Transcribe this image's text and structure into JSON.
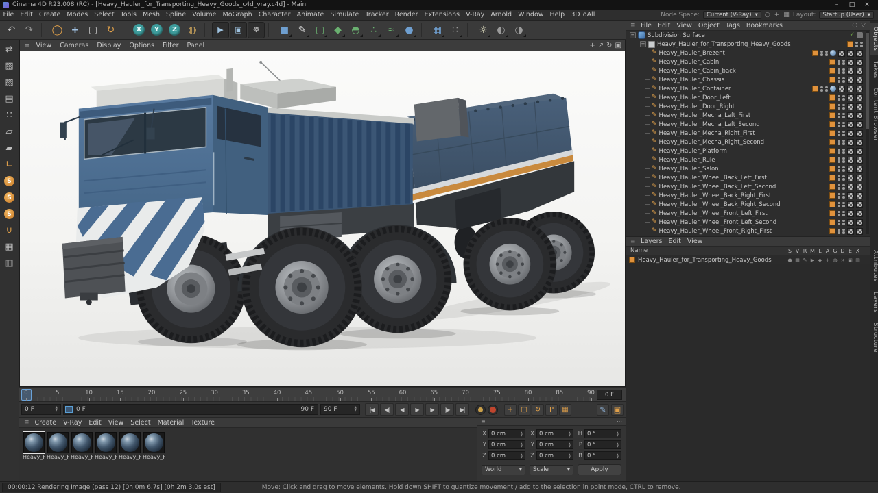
{
  "window": {
    "title": "Cinema 4D R23.008 (RC) - [Heavy_Hauler_for_Transporting_Heavy_Goods_c4d_vray.c4d] - Main",
    "minimize": "–",
    "maximize": "□",
    "close": "×"
  },
  "icons": {
    "burger": "≡",
    "dots": "⋯",
    "caret": "▾",
    "minus": "−",
    "spin_up": "▲",
    "spin_down": "▼",
    "mesh_glyph": "✎",
    "check": "✓"
  },
  "menu_bar": {
    "items": [
      "File",
      "Edit",
      "Create",
      "Modes",
      "Select",
      "Tools",
      "Mesh",
      "Spline",
      "Volume",
      "MoGraph",
      "Character",
      "Animate",
      "Simulate",
      "Tracker",
      "Render",
      "Extensions",
      "V-Ray",
      "Arnold",
      "Window",
      "Help",
      "3DToAll"
    ],
    "node_space_label": "Node Space:",
    "node_space_value": "Current (V-Ray)",
    "layout_label": "Layout:",
    "layout_value": "Startup (User)",
    "right_icons": [
      {
        "name": "search-icon",
        "glyph": "○"
      },
      {
        "name": "customize-icon",
        "glyph": "+"
      },
      {
        "name": "panels-icon",
        "glyph": "▦"
      }
    ]
  },
  "toolbar": {
    "buttons": [
      {
        "name": "undo-button",
        "glyph": "↶",
        "color": "#c6c6c6"
      },
      {
        "name": "redo-button",
        "glyph": "↷",
        "color": "#8f8f8f"
      },
      {
        "sep": true
      },
      {
        "name": "live-selection-button",
        "glyph": "◯",
        "color": "#e0a04a"
      },
      {
        "name": "move-tool-button",
        "glyph": "+",
        "color": "#9fc0e0",
        "bold": true
      },
      {
        "name": "scale-tool-button",
        "glyph": "▢",
        "color": "#c6c6c6"
      },
      {
        "name": "rotate-tool-button",
        "glyph": "↻",
        "color": "#e0a04a"
      },
      {
        "sep": true
      },
      {
        "name": "x-axis-lock-button",
        "glyph": "X",
        "circle": "#3e9c9c"
      },
      {
        "name": "y-axis-lock-button",
        "glyph": "Y",
        "circle": "#3e9c9c"
      },
      {
        "name": "z-axis-lock-button",
        "glyph": "Z",
        "circle": "#3e9c9c"
      },
      {
        "name": "coordinate-system-button",
        "glyph": "◍",
        "color": "#c6a05a"
      },
      {
        "sep": true
      },
      {
        "name": "render-view-button",
        "glyph": "▶",
        "color": "#9fc3e0",
        "boxed": true
      },
      {
        "name": "render-picture-viewer-button",
        "glyph": "▣",
        "color": "#9fc3e0",
        "boxed": true
      },
      {
        "name": "render-settings-button",
        "glyph": "☸",
        "color": "#c2c2c2",
        "boxed": true
      },
      {
        "sep": true
      },
      {
        "name": "add-cube-button",
        "glyph": "■",
        "color": "#6f9fd0",
        "flyout": true
      },
      {
        "name": "spline-pen-button",
        "glyph": "✎",
        "color": "#d0d0d0",
        "flyout": true
      },
      {
        "name": "subdivision-surface-button",
        "glyph": "▢",
        "color": "#6ab070",
        "flyout": true
      },
      {
        "name": "symmetry-button",
        "glyph": "◆",
        "color": "#6ab070",
        "flyout": true
      },
      {
        "name": "boole-button",
        "glyph": "◓",
        "color": "#6ab070",
        "flyout": true
      },
      {
        "name": "cloner-button",
        "glyph": "∴",
        "color": "#6ab070",
        "flyout": true
      },
      {
        "name": "field-button",
        "glyph": "≈",
        "color": "#6ab070",
        "flyout": true
      },
      {
        "name": "volume-builder-button",
        "glyph": "●",
        "color": "#6f9fd0",
        "flyout": true
      },
      {
        "sep": true
      },
      {
        "name": "mograph-table-button",
        "glyph": "▦",
        "color": "#6f9fd0",
        "flyout": true
      },
      {
        "name": "particles-button",
        "glyph": "∷",
        "color": "#9b9b9b",
        "flyout": true
      },
      {
        "sep": true
      },
      {
        "name": "light-button",
        "glyph": "☼",
        "color": "#e6e4c6",
        "flyout": true
      },
      {
        "name": "sky-button",
        "glyph": "◐",
        "color": "#9b9b9b",
        "flyout": true
      },
      {
        "name": "environment-button",
        "glyph": "◑",
        "color": "#9b9b9b",
        "flyout": true
      }
    ]
  },
  "left_toolbar": {
    "buttons": [
      {
        "name": "make-editable-button",
        "glyph": "⇄",
        "color": "#bcbcbc"
      },
      {
        "name": "model-mode-button",
        "glyph": "▧",
        "color": "#bcbcbc"
      },
      {
        "name": "texture-mode-button",
        "glyph": "▨",
        "color": "#bcbcbc"
      },
      {
        "name": "workplane-mode-button",
        "glyph": "▤",
        "color": "#bcbcbc"
      },
      {
        "name": "points-mode-button",
        "glyph": "∷",
        "color": "#bcbcbc"
      },
      {
        "name": "edges-mode-button",
        "glyph": "▱",
        "color": "#bcbcbc"
      },
      {
        "name": "polygons-mode-button",
        "glyph": "▰",
        "color": "#bcbcbc"
      },
      {
        "name": "enable-axis-button",
        "glyph": "∟",
        "color": "#e0a04a"
      },
      {
        "name": "viewport-solo-off-button",
        "glyph": "S",
        "round": true
      },
      {
        "name": "viewport-solo-single-button",
        "glyph": "S",
        "round": true
      },
      {
        "name": "viewport-solo-hierarchy-button",
        "glyph": "S",
        "round": true
      },
      {
        "name": "snap-button",
        "glyph": "∪",
        "color": "#e0a04a"
      },
      {
        "name": "quantize-button",
        "glyph": "▦",
        "color": "#bcbcbc"
      },
      {
        "name": "workplane-lock-button",
        "glyph": "▥",
        "color": "#8f8f8f"
      }
    ]
  },
  "viewport": {
    "menu_items": [
      "View",
      "Cameras",
      "Display",
      "Options",
      "Filter",
      "Panel"
    ],
    "nav_icons": [
      {
        "name": "pan-view-icon",
        "glyph": "+"
      },
      {
        "name": "zoom-view-icon",
        "glyph": "↗"
      },
      {
        "name": "rotate-view-icon",
        "glyph": "↻"
      },
      {
        "name": "toggle-view-icon",
        "glyph": "▣"
      }
    ]
  },
  "viewport_scene": {
    "model": "Heavy Hauler for Transporting Heavy Goods",
    "view": "three-quarter front-left perspective",
    "colors": {
      "cabin_blue": "#4e6f93",
      "container_blue": "#41556b",
      "accent_orange": "#c98a3e",
      "camo_white": "#e9ebeb",
      "tire": "#2a2b2d",
      "hub": "#8e9195",
      "background_top": "#fbfbfa",
      "background_bottom": "#e7e7e5"
    }
  },
  "object_manager": {
    "menu_items": [
      "File",
      "Edit",
      "View",
      "Object",
      "Tags",
      "Bookmarks"
    ],
    "menu_icons": [
      {
        "name": "search-icon",
        "glyph": "○"
      },
      {
        "name": "filter-icon",
        "glyph": "▽"
      }
    ],
    "rows": [
      {
        "label": "Subdivision Surface",
        "level": 0,
        "type": "sds",
        "expander": true,
        "tags": [
          "check",
          "gray"
        ]
      },
      {
        "label": "Heavy_Hauler_for_Transporting_Heavy_Goods",
        "level": 1,
        "type": "null",
        "expander": true,
        "tags": [
          "layer",
          "dots"
        ]
      },
      {
        "label": "Heavy_Hauler_Brezent",
        "level": 2,
        "type": "mesh",
        "tags": [
          "layer",
          "dots",
          "ball",
          "mat",
          "mat",
          "mat"
        ]
      },
      {
        "label": "Heavy_Hauler_Cabin",
        "level": 2,
        "type": "mesh",
        "tags": [
          "layer",
          "dots",
          "mat",
          "mat"
        ]
      },
      {
        "label": "Heavy_Hauler_Cabin_back",
        "level": 2,
        "type": "mesh",
        "tags": [
          "layer",
          "dots",
          "mat",
          "mat"
        ]
      },
      {
        "label": "Heavy_Hauler_Chassis",
        "level": 2,
        "type": "mesh",
        "tags": [
          "layer",
          "dots",
          "mat",
          "mat"
        ]
      },
      {
        "label": "Heavy_Hauler_Container",
        "level": 2,
        "type": "mesh",
        "tags": [
          "layer",
          "dots",
          "ball",
          "mat",
          "mat",
          "mat"
        ]
      },
      {
        "label": "Heavy_Hauler_Door_Left",
        "level": 2,
        "type": "mesh",
        "tags": [
          "layer",
          "dots",
          "mat",
          "mat"
        ]
      },
      {
        "label": "Heavy_Hauler_Door_Right",
        "level": 2,
        "type": "mesh",
        "tags": [
          "layer",
          "dots",
          "mat",
          "mat"
        ]
      },
      {
        "label": "Heavy_Hauler_Mecha_Left_First",
        "level": 2,
        "type": "mesh",
        "tags": [
          "layer",
          "dots",
          "mat",
          "mat"
        ]
      },
      {
        "label": "Heavy_Hauler_Mecha_Left_Second",
        "level": 2,
        "type": "mesh",
        "tags": [
          "layer",
          "dots",
          "mat",
          "mat"
        ]
      },
      {
        "label": "Heavy_Hauler_Mecha_Right_First",
        "level": 2,
        "type": "mesh",
        "tags": [
          "layer",
          "dots",
          "mat",
          "mat"
        ]
      },
      {
        "label": "Heavy_Hauler_Mecha_Right_Second",
        "level": 2,
        "type": "mesh",
        "tags": [
          "layer",
          "dots",
          "mat",
          "mat"
        ]
      },
      {
        "label": "Heavy_Hauler_Platform",
        "level": 2,
        "type": "mesh",
        "tags": [
          "layer",
          "dots",
          "mat",
          "mat"
        ]
      },
      {
        "label": "Heavy_Hauler_Rule",
        "level": 2,
        "type": "mesh",
        "tags": [
          "layer",
          "dots",
          "mat",
          "mat"
        ]
      },
      {
        "label": "Heavy_Hauler_Salon",
        "level": 2,
        "type": "mesh",
        "tags": [
          "layer",
          "dots",
          "mat",
          "mat"
        ]
      },
      {
        "label": "Heavy_Hauler_Wheel_Back_Left_First",
        "level": 2,
        "type": "mesh",
        "tags": [
          "layer",
          "dots",
          "mat",
          "mat"
        ]
      },
      {
        "label": "Heavy_Hauler_Wheel_Back_Left_Second",
        "level": 2,
        "type": "mesh",
        "tags": [
          "layer",
          "dots",
          "mat",
          "mat"
        ]
      },
      {
        "label": "Heavy_Hauler_Wheel_Back_Right_First",
        "level": 2,
        "type": "mesh",
        "tags": [
          "layer",
          "dots",
          "mat",
          "mat"
        ]
      },
      {
        "label": "Heavy_Hauler_Wheel_Back_Right_Second",
        "level": 2,
        "type": "mesh",
        "tags": [
          "layer",
          "dots",
          "mat",
          "mat"
        ]
      },
      {
        "label": "Heavy_Hauler_Wheel_Front_Left_First",
        "level": 2,
        "type": "mesh",
        "tags": [
          "layer",
          "dots",
          "mat",
          "mat"
        ]
      },
      {
        "label": "Heavy_Hauler_Wheel_Front_Left_Second",
        "level": 2,
        "type": "mesh",
        "tags": [
          "layer",
          "dots",
          "mat",
          "mat"
        ]
      },
      {
        "label": "Heavy_Hauler_Wheel_Front_Right_First",
        "level": 2,
        "type": "mesh",
        "tags": [
          "layer",
          "dots",
          "mat",
          "mat"
        ]
      }
    ]
  },
  "layer_manager": {
    "menu_items": [
      "Layers",
      "Edit",
      "View"
    ],
    "name_header": "Name",
    "column_letters": [
      "S",
      "V",
      "R",
      "M",
      "L",
      "A",
      "G",
      "D",
      "E",
      "X"
    ],
    "row_label": "Heavy_Hauler_for_Transporting_Heavy_Goods",
    "row_icons": [
      "●",
      "▦",
      "✎",
      "▶",
      "◆",
      "+",
      "◍",
      "×",
      "▣",
      "▥"
    ]
  },
  "panel_tabs": {
    "top": [
      "Objects",
      "Takes",
      "Content Browser"
    ],
    "bottom": [
      "Attributes",
      "Layers",
      "Structure"
    ]
  },
  "timeline": {
    "ticks": [
      0,
      5,
      10,
      15,
      20,
      25,
      30,
      35,
      40,
      45,
      50,
      55,
      60,
      65,
      70,
      75,
      80,
      85,
      90
    ],
    "frame_field": "0 F"
  },
  "transport": {
    "current_frame": "0 F",
    "range_start": "0 F",
    "range_end": "90 F",
    "end_frame": "90 F",
    "buttons": [
      {
        "name": "go-to-start-button",
        "glyph": "|◀"
      },
      {
        "name": "previous-key-button",
        "glyph": "◀|"
      },
      {
        "name": "previous-frame-button",
        "glyph": "◀"
      },
      {
        "name": "play-button",
        "glyph": "▶"
      },
      {
        "name": "next-frame-button",
        "glyph": "▶"
      },
      {
        "name": "next-key-button",
        "glyph": "|▶"
      },
      {
        "name": "go-to-end-button",
        "glyph": "▶|"
      }
    ],
    "record_buttons": [
      {
        "name": "record-keyframe-button",
        "style": "key"
      },
      {
        "name": "autokey-button",
        "style": "red"
      }
    ],
    "record_toggles": [
      {
        "name": "record-position-toggle",
        "glyph": "+"
      },
      {
        "name": "record-scale-toggle",
        "glyph": "▢"
      },
      {
        "name": "record-rotation-toggle",
        "glyph": "↻"
      },
      {
        "name": "record-parameter-toggle",
        "glyph": "P"
      },
      {
        "name": "record-pla-toggle",
        "glyph": "▦"
      }
    ],
    "right_buttons": [
      {
        "name": "keyframe-presets-button",
        "glyph": "✎",
        "color": "#8fb3d9"
      },
      {
        "name": "solo-mode-button",
        "glyph": "▣",
        "color": "#e0a04a"
      }
    ]
  },
  "material_manager": {
    "menu_items": [
      "Create",
      "V-Ray",
      "Edit",
      "View",
      "Select",
      "Material",
      "Texture"
    ],
    "materials": [
      {
        "label": "Heavy_H"
      },
      {
        "label": "Heavy_H"
      },
      {
        "label": "Heavy_H"
      },
      {
        "label": "Heavy_H"
      },
      {
        "label": "Heavy_H"
      },
      {
        "label": "Heavy_H"
      }
    ]
  },
  "coordinates": {
    "fields": [
      {
        "name": "position-x-field",
        "label": "X",
        "value": "0 cm"
      },
      {
        "name": "size-x-field",
        "label": "X",
        "value": "0 cm"
      },
      {
        "name": "rotation-h-field",
        "label": "H",
        "value": "0 °"
      },
      {
        "name": "position-y-field",
        "label": "Y",
        "value": "0 cm"
      },
      {
        "name": "size-y-field",
        "label": "Y",
        "value": "0 cm"
      },
      {
        "name": "rotation-p-field",
        "label": "P",
        "value": "0 °"
      },
      {
        "name": "position-z-field",
        "label": "Z",
        "value": "0 cm"
      },
      {
        "name": "size-z-field",
        "label": "Z",
        "value": "0 cm"
      },
      {
        "name": "rotation-b-field",
        "label": "B",
        "value": "0 °"
      }
    ],
    "mode_left": "World",
    "mode_middle": "Scale",
    "apply_label": "Apply"
  },
  "status_bar": {
    "render_status": "00:00:12 Rendering Image (pass 12) [0h 0m 6.7s] [0h 2m 3.0s est]",
    "hint": "Move: Click and drag to move elements. Hold down SHIFT to quantize movement / add to the selection in point mode, CTRL to remove."
  }
}
